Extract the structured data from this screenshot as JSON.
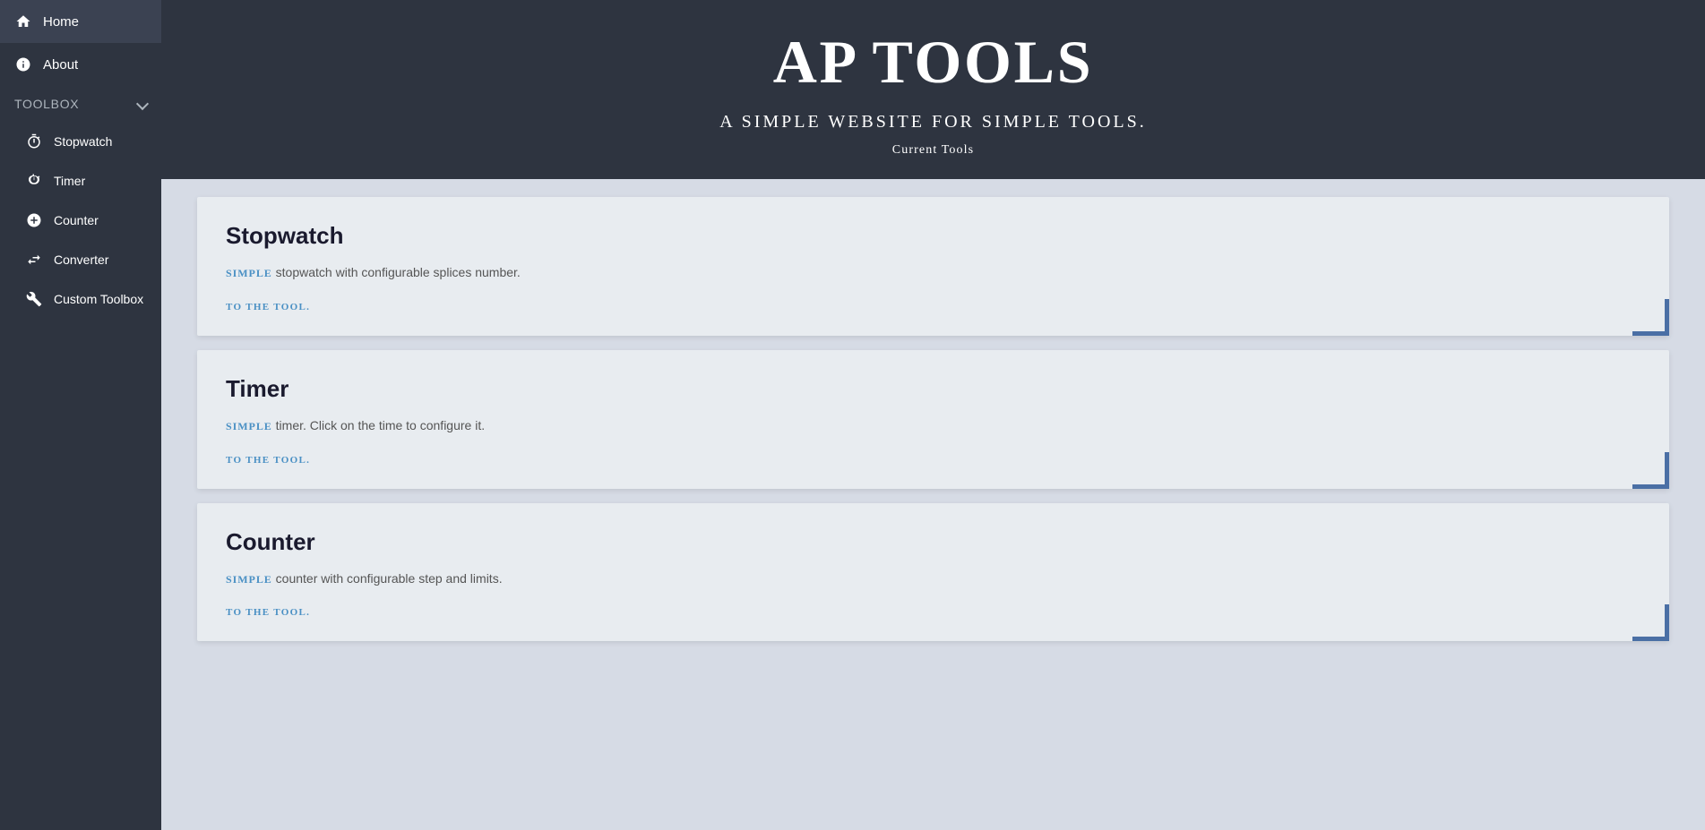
{
  "sidebar": {
    "items": [
      {
        "id": "home",
        "label": "Home",
        "icon": "home-icon",
        "type": "top"
      },
      {
        "id": "about",
        "label": "About",
        "icon": "info-icon",
        "type": "top"
      }
    ],
    "toolbox_section": {
      "label": "Toolbox",
      "expanded": true,
      "sub_items": [
        {
          "id": "stopwatch",
          "label": "Stopwatch",
          "icon": "stopwatch-icon"
        },
        {
          "id": "timer",
          "label": "Timer",
          "icon": "timer-icon"
        },
        {
          "id": "counter",
          "label": "Counter",
          "icon": "counter-icon"
        },
        {
          "id": "converter",
          "label": "Converter",
          "icon": "converter-icon"
        },
        {
          "id": "custom-toolbox",
          "label": "Custom Toolbox",
          "icon": "wrench-icon"
        }
      ]
    }
  },
  "header": {
    "title": "AP Tools",
    "subtitle": "A simple website for simple tools.",
    "current_tools_label": "Current Tools"
  },
  "cards": [
    {
      "id": "stopwatch-card",
      "title": "Stopwatch",
      "simple_badge": "Simple",
      "description": " stopwatch with configurable splices number.",
      "link_label": "To the tool."
    },
    {
      "id": "timer-card",
      "title": "Timer",
      "simple_badge": "Simple",
      "description": " timer. Click on the time to configure it.",
      "link_label": "To the tool."
    },
    {
      "id": "counter-card",
      "title": "Counter",
      "simple_badge": "Simple",
      "description": " counter with configurable step and limits.",
      "link_label": "To the tool."
    }
  ]
}
